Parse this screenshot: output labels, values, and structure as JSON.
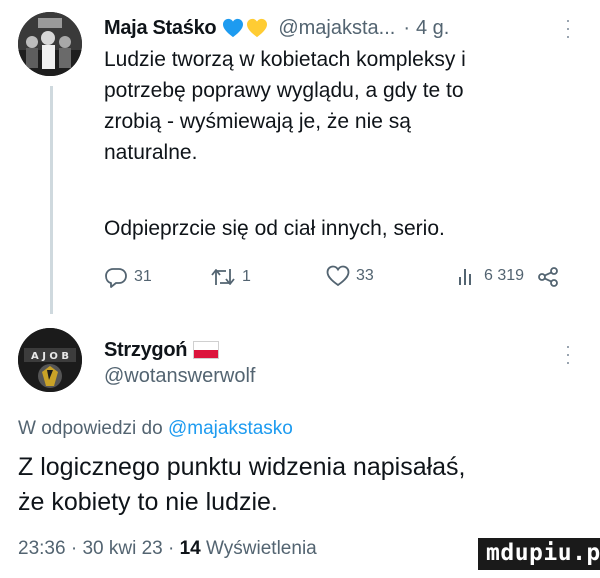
{
  "tweet1": {
    "author_name": "Maja Staśko",
    "author_emojis": "💙💛",
    "handle": "@majaksta...",
    "separator": "·",
    "time": "4 g.",
    "text_lines": [
      "Ludzie tworzą w kobietach kompleksy i",
      "potrzebę poprawy wyglądu, a gdy te to",
      "zrobią - wyśmiewają je, że nie są",
      "naturalne."
    ],
    "text_line_2": "Odpieprzcie się od ciał innych, serio.",
    "stats": {
      "replies": "31",
      "retweets": "1",
      "likes": "33",
      "views": "6 319"
    },
    "icons": {
      "reply": "reply-icon",
      "retweet": "retweet-icon",
      "like": "heart-icon",
      "views": "views-bar-icon",
      "share": "share-icon",
      "more": "more-icon"
    }
  },
  "tweet2": {
    "author_name": "Strzygoń",
    "flag": "polish-flag-icon",
    "handle": "@wotanswerwolf",
    "reply_prefix": "W odpowiedzi do",
    "reply_to": "@majakstasko",
    "text_lines": [
      "Z logicznego punktu widzenia napisałaś,",
      "że kobiety to nie ludzie."
    ],
    "meta": {
      "time": "23:36",
      "sep1": "·",
      "date": "30 kwi 23",
      "sep2": "·",
      "views_count": "14",
      "views_label": "Wyświetlenia"
    }
  },
  "watermark": "mdupiu.pl",
  "colors": {
    "text": "#0f1419",
    "muted": "#536471",
    "link": "#1d9bf0",
    "heart_blue": "#1d9bf0",
    "heart_yellow": "#ffcc33"
  }
}
